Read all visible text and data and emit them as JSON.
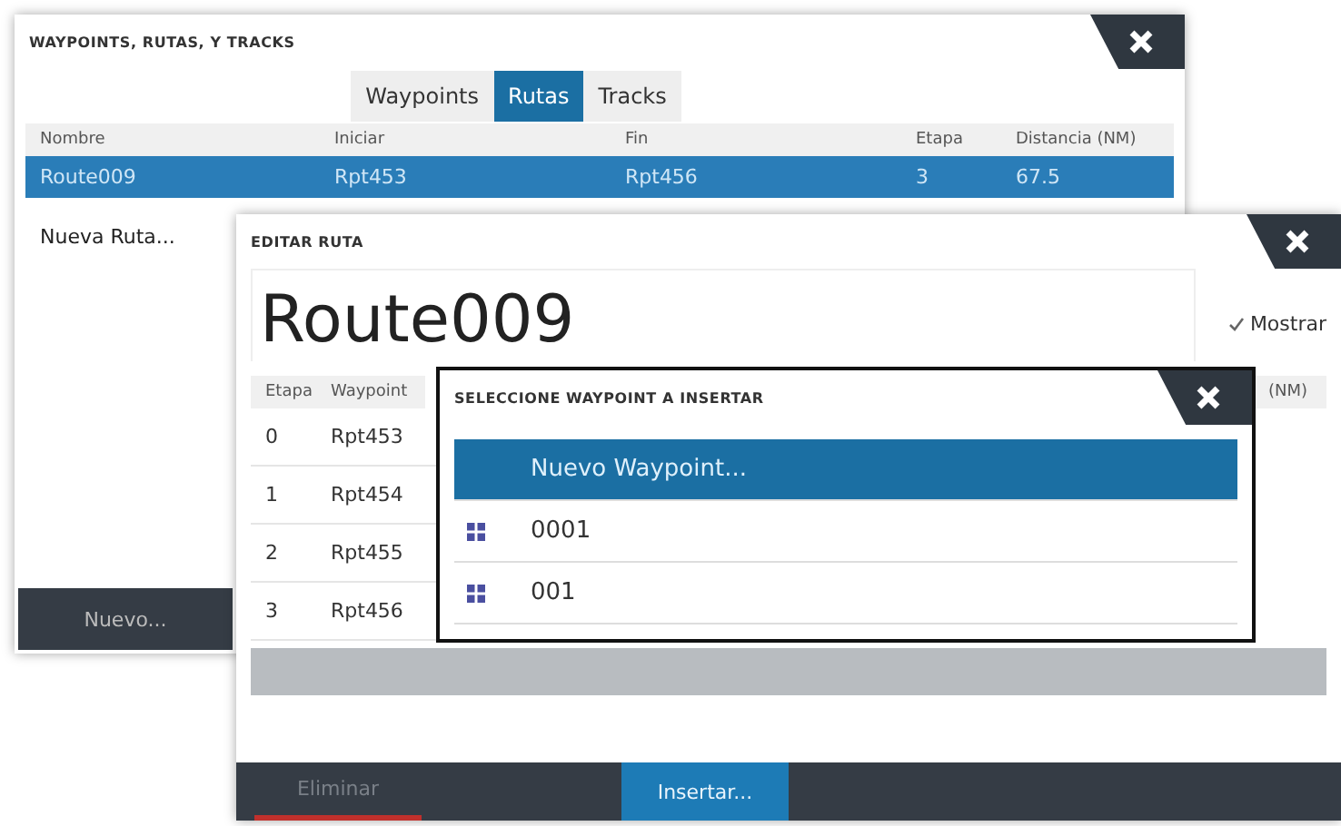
{
  "routes_window": {
    "title": "WAYPOINTS, RUTAS, Y TRACKS",
    "tabs": [
      {
        "label": "Waypoints",
        "selected": false
      },
      {
        "label": "Rutas",
        "selected": true
      },
      {
        "label": "Tracks",
        "selected": false
      }
    ],
    "columns": [
      "Nombre",
      "Iniciar",
      "Fin",
      "Etapa",
      "Distancia (NM)"
    ],
    "rows": [
      {
        "cells": [
          "Route009",
          "Rpt453",
          "Rpt456",
          "3",
          "67.5"
        ],
        "selected": true
      },
      {
        "cells": [
          "Nueva Ruta..."
        ],
        "selected": false
      }
    ],
    "new_button": "Nuevo..."
  },
  "edit_window": {
    "title": "EDITAR RUTA",
    "route_name": "Route009",
    "show": {
      "label": "Mostrar",
      "checked": true
    },
    "columns": [
      "Etapa",
      "Waypoint",
      "(NM)"
    ],
    "rows": [
      [
        "0",
        "Rpt453"
      ],
      [
        "1",
        "Rpt454"
      ],
      [
        "2",
        "Rpt455"
      ],
      [
        "3",
        "Rpt456"
      ]
    ],
    "buttons": [
      {
        "label": "Eliminar",
        "kind": "delete"
      },
      {
        "label": "Insertar...",
        "kind": "insert"
      }
    ]
  },
  "select_window": {
    "title": "SELECCIONE WAYPOINT A INSERTAR",
    "items": [
      {
        "label": "Nuevo Waypoint...",
        "kind": "new",
        "selected": true
      },
      {
        "label": "0001",
        "kind": "waypoint",
        "selected": false
      },
      {
        "label": "001",
        "kind": "waypoint",
        "selected": false
      }
    ]
  }
}
